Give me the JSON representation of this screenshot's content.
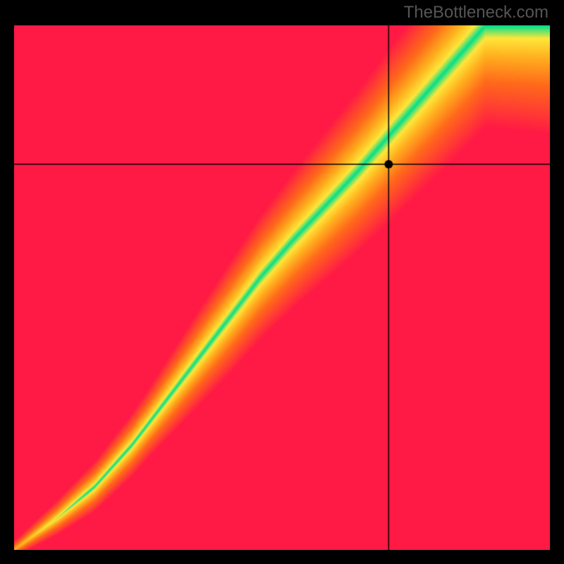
{
  "brand": "TheBottleneck.com",
  "chart_data": {
    "type": "heatmap",
    "title": "",
    "xlabel": "",
    "ylabel": "",
    "xlim": [
      0,
      100
    ],
    "ylim": [
      0,
      100
    ],
    "ridge": [
      {
        "x": 0,
        "y": 0
      },
      {
        "x": 8,
        "y": 6
      },
      {
        "x": 15,
        "y": 12
      },
      {
        "x": 22,
        "y": 20
      },
      {
        "x": 28,
        "y": 28
      },
      {
        "x": 34,
        "y": 36
      },
      {
        "x": 40,
        "y": 44
      },
      {
        "x": 46,
        "y": 52
      },
      {
        "x": 52,
        "y": 59
      },
      {
        "x": 58,
        "y": 65.5
      },
      {
        "x": 64,
        "y": 72
      },
      {
        "x": 70,
        "y": 79
      },
      {
        "x": 76,
        "y": 86
      },
      {
        "x": 82,
        "y": 93
      },
      {
        "x": 88,
        "y": 100
      }
    ],
    "ridge_width": [
      {
        "x": 0,
        "w": 0.5
      },
      {
        "x": 10,
        "w": 1.5
      },
      {
        "x": 25,
        "w": 3.2
      },
      {
        "x": 40,
        "w": 5.8
      },
      {
        "x": 55,
        "w": 7.6
      },
      {
        "x": 70,
        "w": 9.5
      },
      {
        "x": 85,
        "w": 11
      },
      {
        "x": 100,
        "w": 12
      }
    ],
    "marker": {
      "x": 70,
      "y": 73.5
    },
    "colors": {
      "optimal": "#00e08c",
      "near": "#ffe63a",
      "warm": "#ffaf1e",
      "hot": "#ff6a1a",
      "bad": "#ff1a45"
    }
  }
}
